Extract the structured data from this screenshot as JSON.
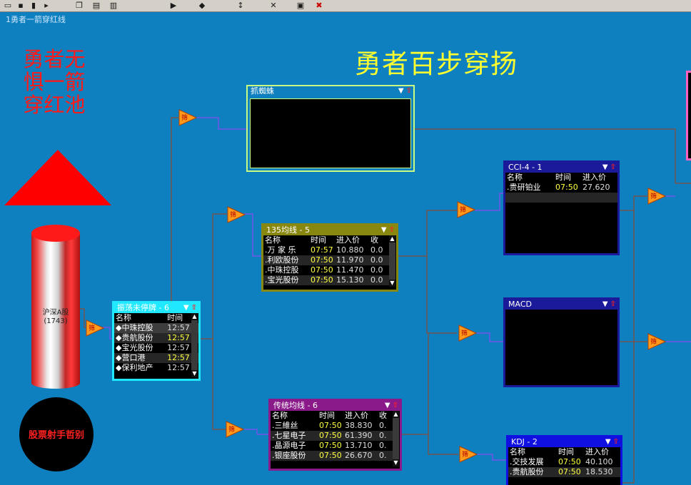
{
  "window": {
    "title": "1勇者一箭穿红线"
  },
  "heading": "勇者百步穿扬",
  "slogan": [
    "勇者无",
    "惧一箭",
    "穿红池"
  ],
  "source": {
    "name": "沪深A股",
    "count": "(1743)"
  },
  "brand": "股票射手哲别",
  "toolbar": {
    "icons": [
      "folder-icon",
      "save-icon",
      "chart-icon",
      "arrow-icon",
      "copy-icon",
      "paste-icon",
      "print-icon",
      "play-icon",
      "filter-icon",
      "sort-icon",
      "delete-icon",
      "link-icon",
      "close-icon"
    ]
  },
  "filter_label": "筛",
  "panels": {
    "zhenfu": {
      "title": "振荡未停牌 - 6",
      "headers": [
        "名称",
        "时间"
      ],
      "rows": [
        {
          "name": "中珠控股",
          "time": "12:57"
        },
        {
          "name": "贵航股份",
          "time": "12:57"
        },
        {
          "name": "宝光股份",
          "time": "12:57"
        },
        {
          "name": "营口港",
          "time": "12:57"
        },
        {
          "name": "保利地产",
          "time": "12:57"
        }
      ]
    },
    "zhuazhizhu": {
      "title": "抓蜘蛛"
    },
    "ma135": {
      "title": "135均线 - 5",
      "headers": [
        "名称",
        "时间",
        "进入价",
        "收"
      ],
      "rows": [
        {
          "name": "万 家 乐",
          "time": "07:57",
          "price": "10.880",
          "last": "0.0"
        },
        {
          "name": "利欧股份",
          "time": "07:50",
          "price": "11.970",
          "last": "0.0"
        },
        {
          "name": "中珠控股",
          "time": "07:50",
          "price": "11.470",
          "last": "0.0"
        },
        {
          "name": "宝光股份",
          "time": "07:50",
          "price": "15.130",
          "last": "0.0"
        }
      ]
    },
    "chuantong": {
      "title": "传统均线 - 6",
      "headers": [
        "名称",
        "时间",
        "进入价",
        "收"
      ],
      "rows": [
        {
          "name": "三維丝",
          "time": "07:50",
          "price": "38.830",
          "last": "0."
        },
        {
          "name": "七星电子",
          "time": "07:50",
          "price": "61.390",
          "last": "0."
        },
        {
          "name": "晶源电子",
          "time": "07:50",
          "price": "13.710",
          "last": "0."
        },
        {
          "name": "银座股份",
          "time": "07:50",
          "price": "26.670",
          "last": "0."
        }
      ]
    },
    "cci": {
      "title": "CCI-4 - 1",
      "headers": [
        "名称",
        "时间",
        "进入价"
      ],
      "rows": [
        {
          "name": "贵研铂业",
          "time": "07:50",
          "price": "27.620"
        }
      ]
    },
    "macd": {
      "title": "MACD"
    },
    "kdj": {
      "title": "KDJ - 2",
      "headers": [
        "名称",
        "时间",
        "进入价"
      ],
      "rows": [
        {
          "name": "交技发展",
          "time": "07:50",
          "price": "40.100"
        },
        {
          "name": "贵航股份",
          "time": "07:50",
          "price": "18.530"
        }
      ]
    }
  },
  "colors": {
    "background": "#0f80bf",
    "heading": "#ffff30",
    "slogan": "#ff1a1a",
    "link_line": "#a0401e",
    "link_line_purple": "#a040ff",
    "filter_node": "#ff9a1a"
  }
}
